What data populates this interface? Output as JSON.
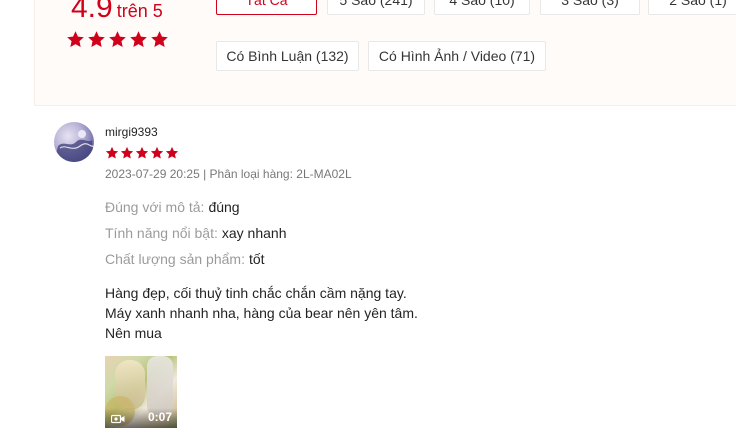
{
  "rating_summary": {
    "score": "4.9",
    "out_of": "trên 5",
    "stars": 5,
    "star_color": "#d0011b"
  },
  "filters": {
    "row1": [
      {
        "label": "Tất Cả",
        "active": true
      },
      {
        "label": "5 Sao (241)",
        "active": false
      },
      {
        "label": "4 Sao (10)",
        "active": false
      },
      {
        "label": "3 Sao (3)",
        "active": false
      },
      {
        "label": "2 Sao (1)",
        "active": false
      }
    ],
    "row2": [
      {
        "label": "Có Bình Luận (132)",
        "active": false
      },
      {
        "label": "Có Hình Ảnh / Video (71)",
        "active": false
      }
    ]
  },
  "review": {
    "username": "mirgi9393",
    "stars": 5,
    "meta": "2023-07-29 20:25 | Phân loại hàng: 2L-MA02L",
    "attributes": [
      {
        "label": "Đúng với mô tả:",
        "value": "đúng"
      },
      {
        "label": "Tính năng nổi bật:",
        "value": "xay nhanh"
      },
      {
        "label": "Chất lượng sản phẩm:",
        "value": "tốt"
      }
    ],
    "comment_lines": [
      "Hàng đẹp, cối thuỷ tinh chắc chắn cầm nặng tay.",
      "Máy xanh nhanh nha, hàng của bear nên yên tâm.",
      "Nên mua"
    ],
    "media": {
      "duration": "0:07",
      "icon": "video-camera-icon"
    }
  }
}
